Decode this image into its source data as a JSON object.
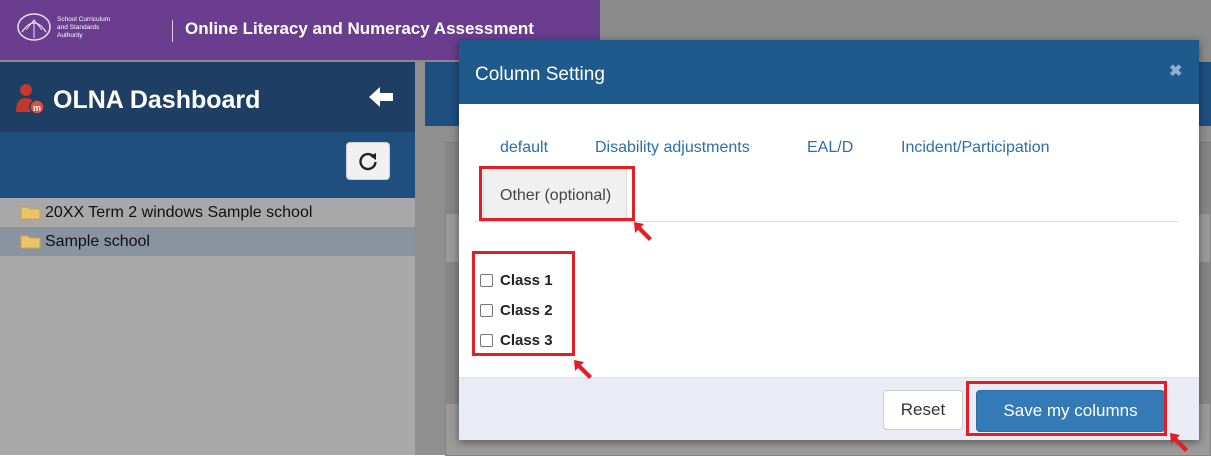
{
  "header": {
    "logo_text": "School Curriculum and Standards Authority",
    "app_title": "Online Literacy and Numeracy Assessment"
  },
  "sidebar": {
    "title": "OLNA Dashboard",
    "tree": [
      {
        "label": "20XX Term 2 windows Sample school",
        "selected": false
      },
      {
        "label": "Sample school",
        "selected": true
      }
    ]
  },
  "modal": {
    "title": "Column Setting",
    "close_symbol": "✖",
    "tabs": [
      {
        "label": "default",
        "active": false
      },
      {
        "label": "Disability adjustments",
        "active": false
      },
      {
        "label": "EAL/D",
        "active": false
      },
      {
        "label": "Incident/Participation",
        "active": false
      },
      {
        "label": "Other (optional)",
        "active": true
      }
    ],
    "checkboxes": [
      {
        "label": "Class 1",
        "checked": false
      },
      {
        "label": "Class 2",
        "checked": false
      },
      {
        "label": "Class 3",
        "checked": false
      }
    ],
    "reset_label": "Reset",
    "save_label": "Save my columns"
  },
  "icons": {
    "dashboard": "dashboard-person-icon",
    "back": "arrow-left-icon",
    "refresh": "refresh-icon",
    "folder": "folder-icon",
    "close": "close-icon",
    "checkbox": "checkbox-icon",
    "callout_arrow": "red-arrow-icon"
  },
  "colors": {
    "brand_purple": "#6a3d8e",
    "dashboard_navy": "#1e3f63",
    "modal_header": "#1e5a8c",
    "link_blue": "#2a6fb0",
    "primary_button": "#337ab7",
    "annotation_red": "#e31e24"
  }
}
